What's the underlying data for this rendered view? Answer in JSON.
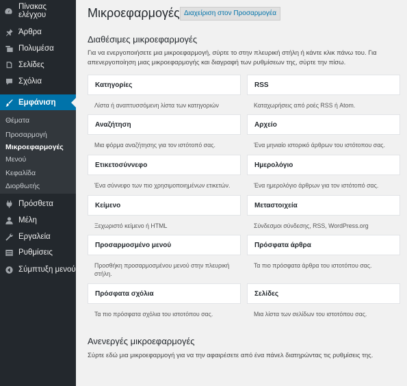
{
  "sidebar": {
    "items": [
      {
        "label": "Πίνακας ελέγχου",
        "icon": "dashboard-icon"
      },
      {
        "label": "Άρθρα",
        "icon": "pin-icon"
      },
      {
        "label": "Πολυμέσα",
        "icon": "media-icon"
      },
      {
        "label": "Σελίδες",
        "icon": "pages-icon"
      },
      {
        "label": "Σχόλια",
        "icon": "comments-icon"
      },
      {
        "label": "Εμφάνιση",
        "icon": "brush-icon",
        "active": true
      },
      {
        "label": "Πρόσθετα",
        "icon": "plugins-icon"
      },
      {
        "label": "Μέλη",
        "icon": "users-icon"
      },
      {
        "label": "Εργαλεία",
        "icon": "wrench-icon"
      },
      {
        "label": "Ρυθμίσεις",
        "icon": "settings-icon"
      },
      {
        "label": "Σύμπτυξη μενού",
        "icon": "collapse-icon"
      }
    ],
    "submenu": [
      {
        "label": "Θέματα"
      },
      {
        "label": "Προσαρμογή"
      },
      {
        "label": "Μικροεφαρμογές",
        "current": true
      },
      {
        "label": "Μενού"
      },
      {
        "label": "Κεφαλίδα"
      },
      {
        "label": "Διορθωτής"
      }
    ],
    "accent_color": "#0073aa"
  },
  "main": {
    "title": "Μικροεφαρμογές",
    "manage_button": "Διαχείριση στον Προσαρμογέα",
    "available": {
      "title": "Διαθέσιμες μικροεφαρμογές",
      "description": "Για να ενεργοποιήσετε μια μικροεφαρμογή, σύρτε το στην πλευρική στήλη ή κάντε κλικ πάνω του. Για απενεργοποίηση μιας μικροεφαρμογής και διαγραφή των ρυθμίσεων της, σύρτε την πίσω."
    },
    "widgets": [
      {
        "title": "Κατηγορίες",
        "desc": "Λίστα ή αναπτυσσόμενη λίστα των κατηγοριών"
      },
      {
        "title": "RSS",
        "desc": "Καταχωρήσεις από ροές RSS ή Atom."
      },
      {
        "title": "Αναζήτηση",
        "desc": "Μια φόρμα αναζήτησης για τον ιστότοπό σας."
      },
      {
        "title": "Αρχείο",
        "desc": "Ένα μηνιαίο ιστορικό άρθρων του ιστότοπου σας."
      },
      {
        "title": "Ετικετοσύννεφο",
        "desc": "Ένα σύννεφο των πιο χρησιμοποιημένων ετικετών."
      },
      {
        "title": "Ημερολόγιο",
        "desc": "Ένα ημερολόγιο άρθρων για τον ιστότοπό σας."
      },
      {
        "title": "Κείμενο",
        "desc": "Ξεχωριστό κείμενο ή HTML"
      },
      {
        "title": "Μεταστοιχεία",
        "desc": "Σύνδεσμοι σύνδεσης, RSS, WordPress.org"
      },
      {
        "title": "Προσαρμοσμένο μενού",
        "desc": "Προσθήκη προσαρμοσμένου μενού στην πλευρική στήλη."
      },
      {
        "title": "Πρόσφατα άρθρα",
        "desc": "Τα πιο πρόσφατα άρθρα του ιστοτόπου σας."
      },
      {
        "title": "Πρόσφατα σχόλια",
        "desc": "Τα πιο πρόσφατα σχόλια του ιστοτόπου σας."
      },
      {
        "title": "Σελίδες",
        "desc": "Μια λίστα των σελίδων του ιστοτόπου σας."
      }
    ],
    "inactive": {
      "title": "Ανενεργές μικροεφαρμογές",
      "description": "Σύρτε εδώ μια μικροεφαρμογή για να την αφαιρέσετε από ένα πάνελ διατηρώντας τις ρυθμίσεις της."
    }
  }
}
